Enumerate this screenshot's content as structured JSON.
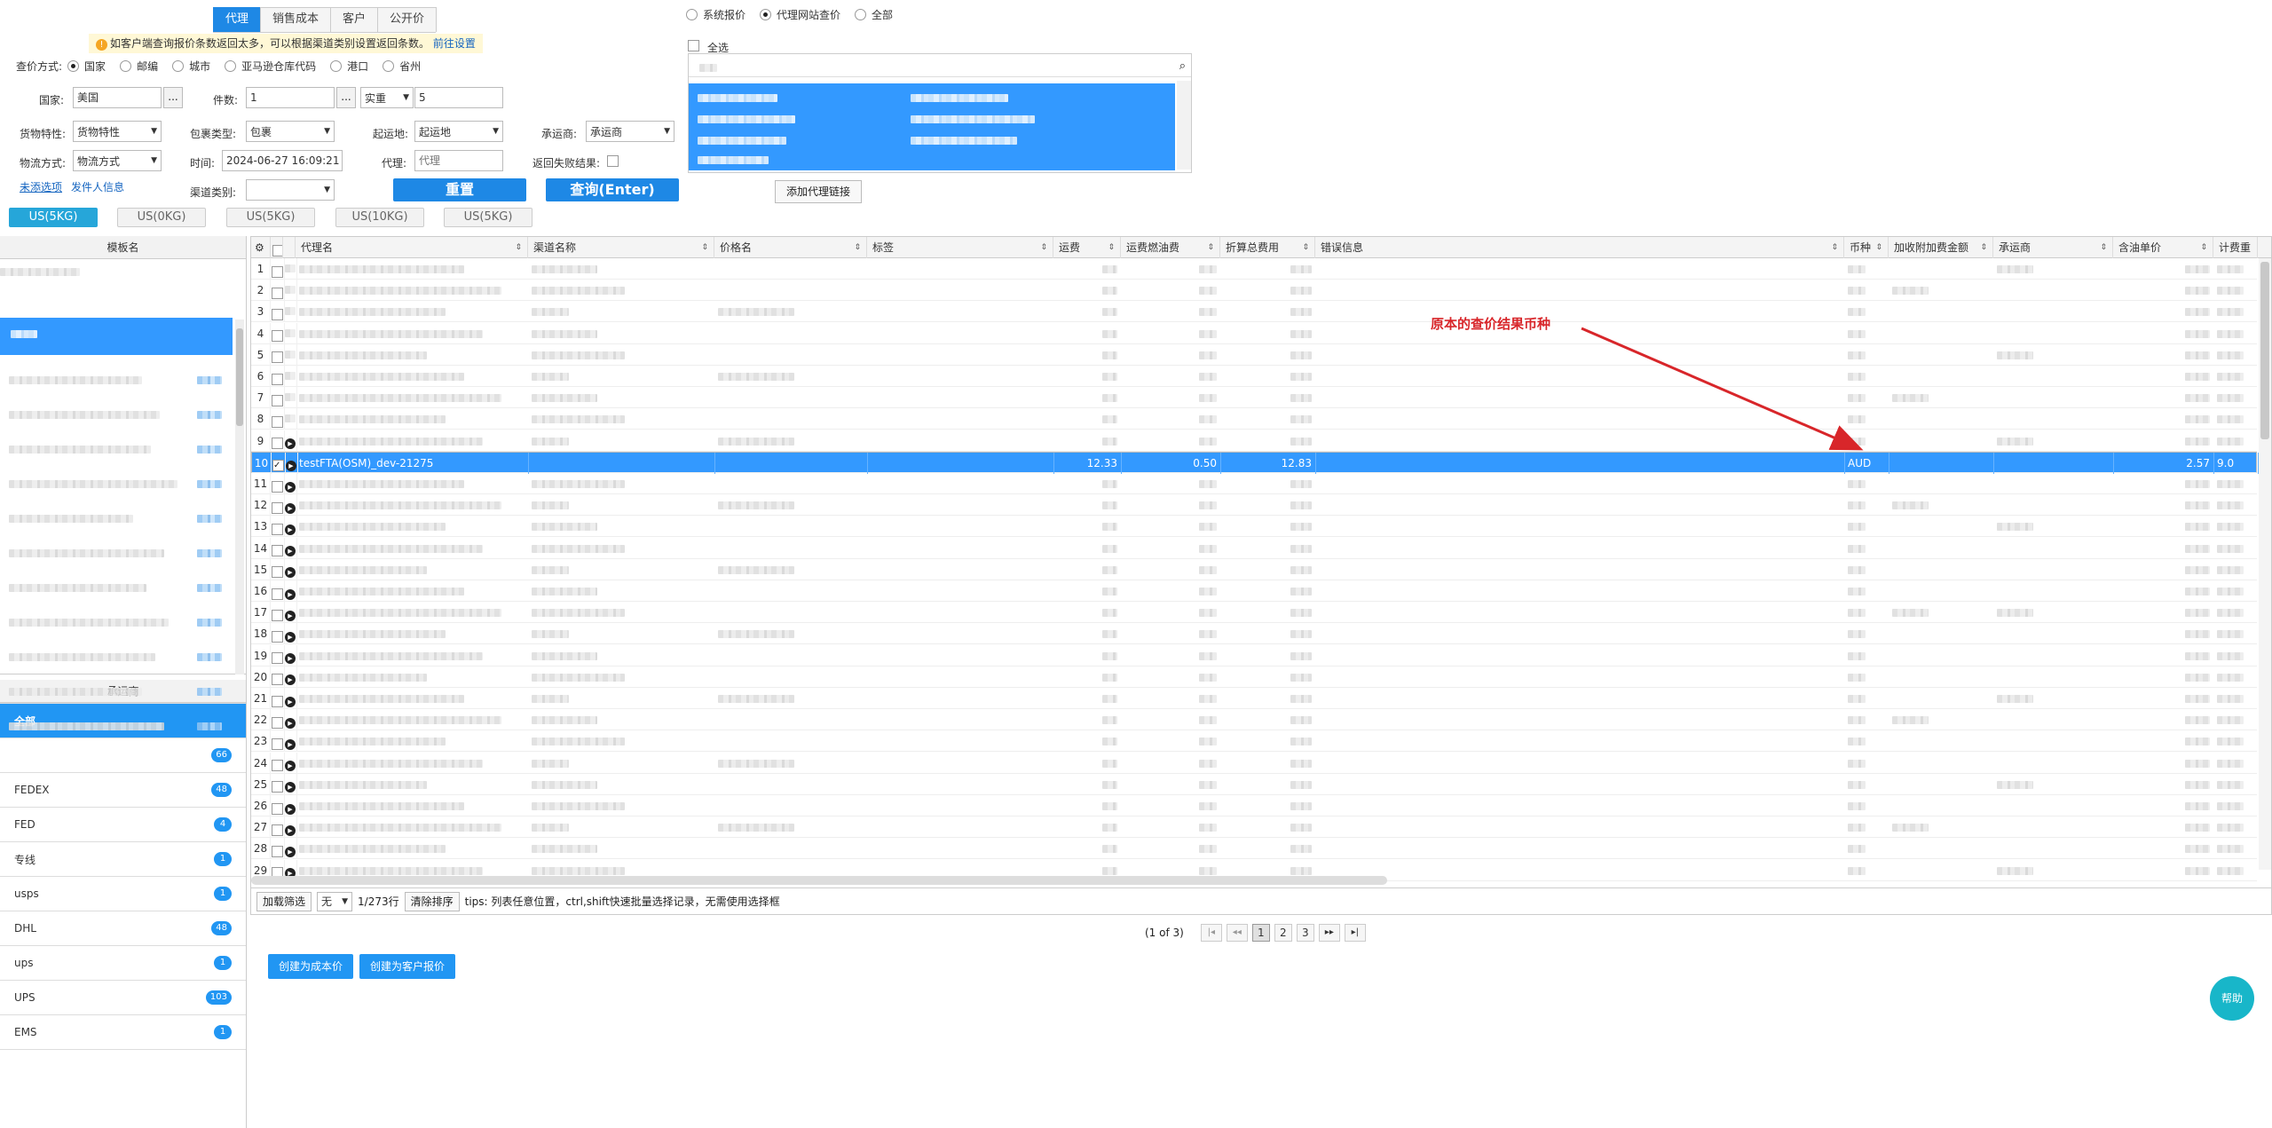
{
  "top_tabs": [
    "代理",
    "销售成本",
    "客户",
    "公开价"
  ],
  "notice": {
    "text": "如客户端查询报价条数返回太多，可以根据渠道类别设置返回条数。",
    "link": "前往设置"
  },
  "search_mode": {
    "label": "查价方式:",
    "options": [
      "国家",
      "邮编",
      "城市",
      "亚马逊仓库代码",
      "港口",
      "省州"
    ]
  },
  "source_mode": {
    "options": [
      "系统报价",
      "代理网站查价",
      "全部"
    ]
  },
  "select_all_label": "全选",
  "add_proxy_link_label": "添加代理链接",
  "form": {
    "country_label": "国家:",
    "country_value": "美国",
    "country_btn": "...",
    "pieces_label": "件数:",
    "pieces_value": "1",
    "pieces_btn": "...",
    "weight_type": "实重",
    "weight_value": "5",
    "goods_label": "货物特性:",
    "goods_value": "货物特性",
    "package_label": "包裹类型:",
    "package_value": "包裹",
    "origin_label": "起运地:",
    "origin_value": "起运地",
    "carrier_label": "承运商:",
    "carrier_value": "承运商",
    "logistics_label": "物流方式:",
    "logistics_value": "物流方式",
    "time_label": "时间:",
    "time_value": "2024-06-27 16:09:21",
    "agent_label": "代理:",
    "agent_placeholder": "代理",
    "fail_label": "返回失败结果:",
    "channel_label": "渠道类别:",
    "more_link": "未添选项",
    "sender_link": "发件人信息",
    "reset_btn": "重置",
    "query_btn": "查询(Enter)"
  },
  "quote_tabs": [
    "US(5KG)",
    "US(0KG)",
    "US(5KG)",
    "US(10KG)",
    "US(5KG)"
  ],
  "template_panel": {
    "header": "模板名"
  },
  "carrier_panel": {
    "header": "承运商",
    "items": [
      {
        "name": "全部",
        "count": ""
      },
      {
        "name": "",
        "count": "66"
      },
      {
        "name": "FEDEX",
        "count": "48"
      },
      {
        "name": "FED",
        "count": "4"
      },
      {
        "name": "专线",
        "count": "1"
      },
      {
        "name": "usps",
        "count": "1"
      },
      {
        "name": "DHL",
        "count": "48"
      },
      {
        "name": "ups",
        "count": "1"
      },
      {
        "name": "UPS",
        "count": "103"
      },
      {
        "name": "EMS",
        "count": "1"
      }
    ]
  },
  "grid": {
    "columns": [
      "代理名",
      "渠道名称",
      "价格名",
      "标签",
      "运费",
      "运费燃油费",
      "折算总费用",
      "错误信息",
      "币种",
      "加收附加费金额",
      "承运商",
      "含油单价",
      "计费重"
    ],
    "selected_row": {
      "index": "10",
      "agent": "testFTA(OSM)_dev-21275",
      "freight": "12.33",
      "fuel": "0.50",
      "total": "12.83",
      "currency": "AUD",
      "unit_price": "2.57",
      "weight": "9.0"
    }
  },
  "footer": {
    "load_filter": "加载筛选",
    "filter_value": "无",
    "rows": "1/273行",
    "clear_sort": "清除排序",
    "tips": "tips: 列表任意位置，ctrl,shift快速批量选择记录，无需使用选择框"
  },
  "pagination": {
    "info": "(1 of 3)",
    "pages": [
      "1",
      "2",
      "3"
    ]
  },
  "actions": {
    "create_cost": "创建为成本价",
    "create_quote": "创建为客户报价"
  },
  "help": "帮助",
  "annotation": "原本的查价结果币种",
  "colors": {
    "accent": "#1e88e5",
    "selected_row": "#3399ff",
    "annotation": "#d8262a",
    "help": "#18b6c9"
  }
}
